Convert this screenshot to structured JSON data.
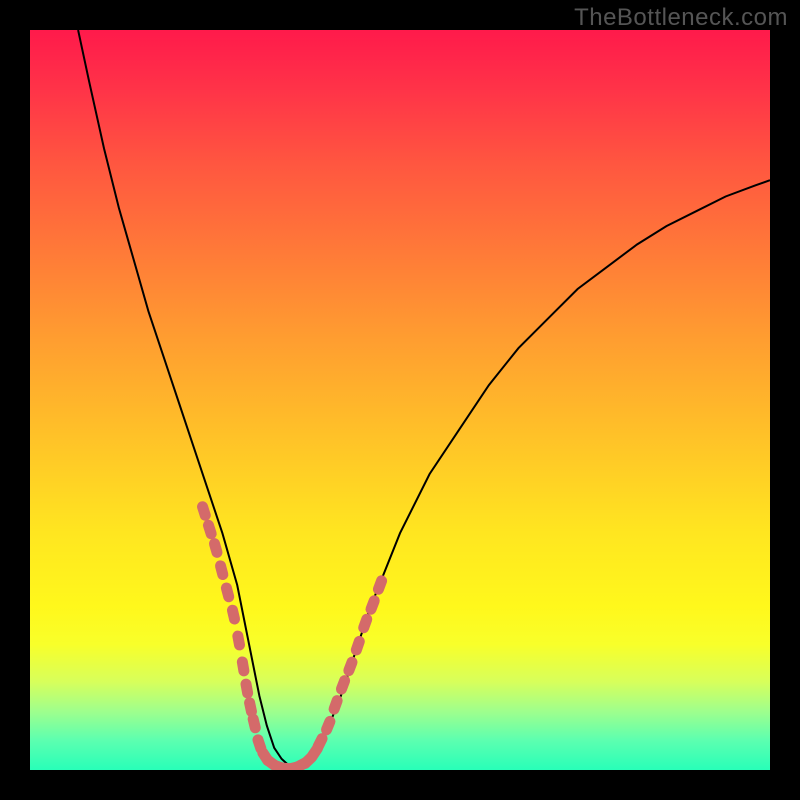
{
  "watermark": "TheBottleneck.com",
  "colors": {
    "background": "#000000",
    "gradient_top": "#ff1a4b",
    "gradient_bottom": "#28ffb8",
    "curve_stroke": "#000000",
    "marker_fill": "#d46a6a"
  },
  "chart_data": {
    "type": "line",
    "title": "",
    "xlabel": "",
    "ylabel": "",
    "xlim": [
      0,
      100
    ],
    "ylim": [
      0,
      100
    ],
    "series": [
      {
        "name": "curve",
        "x": [
          6.5,
          8,
          10,
          12,
          14,
          16,
          18,
          20,
          22,
          24,
          26,
          28,
          29,
          30,
          31,
          32,
          33,
          34,
          35,
          36,
          37,
          38,
          40,
          42,
          44,
          46,
          48,
          50,
          54,
          58,
          62,
          66,
          70,
          74,
          78,
          82,
          86,
          90,
          94,
          98,
          100
        ],
        "y": [
          100,
          93,
          84,
          76,
          69,
          62,
          56,
          50,
          44,
          38,
          32,
          25,
          20,
          15,
          10,
          6,
          3,
          1.5,
          0.6,
          0.3,
          0.6,
          1.5,
          5,
          10,
          16,
          22,
          27,
          32,
          40,
          46,
          52,
          57,
          61,
          65,
          68,
          71,
          73.5,
          75.5,
          77.5,
          79,
          79.7
        ]
      }
    ],
    "markers": {
      "note": "pink capsule markers along lower portion of curve",
      "left_cluster_x_range": [
        23,
        30
      ],
      "right_cluster_x_range": [
        38,
        46
      ],
      "bottom_cluster_x_range": [
        31,
        38
      ],
      "points": [
        {
          "x": 23.5,
          "y": 35
        },
        {
          "x": 24.3,
          "y": 32.5
        },
        {
          "x": 25.1,
          "y": 30
        },
        {
          "x": 25.9,
          "y": 27
        },
        {
          "x": 26.7,
          "y": 24
        },
        {
          "x": 27.5,
          "y": 21
        },
        {
          "x": 28.2,
          "y": 17.5
        },
        {
          "x": 28.8,
          "y": 14
        },
        {
          "x": 29.3,
          "y": 11
        },
        {
          "x": 29.8,
          "y": 8.5
        },
        {
          "x": 30.3,
          "y": 6.3
        },
        {
          "x": 31.0,
          "y": 3.5
        },
        {
          "x": 31.8,
          "y": 1.8
        },
        {
          "x": 32.7,
          "y": 0.9
        },
        {
          "x": 33.7,
          "y": 0.4
        },
        {
          "x": 34.7,
          "y": 0.2
        },
        {
          "x": 35.7,
          "y": 0.3
        },
        {
          "x": 36.7,
          "y": 0.7
        },
        {
          "x": 37.6,
          "y": 1.3
        },
        {
          "x": 38.5,
          "y": 2.4
        },
        {
          "x": 39.2,
          "y": 3.7
        },
        {
          "x": 40.3,
          "y": 6.0
        },
        {
          "x": 41.3,
          "y": 8.8
        },
        {
          "x": 42.3,
          "y": 11.5
        },
        {
          "x": 43.3,
          "y": 14.0
        },
        {
          "x": 44.3,
          "y": 16.8
        },
        {
          "x": 45.3,
          "y": 19.8
        },
        {
          "x": 46.3,
          "y": 22.3
        },
        {
          "x": 47.3,
          "y": 25.0
        }
      ]
    }
  }
}
